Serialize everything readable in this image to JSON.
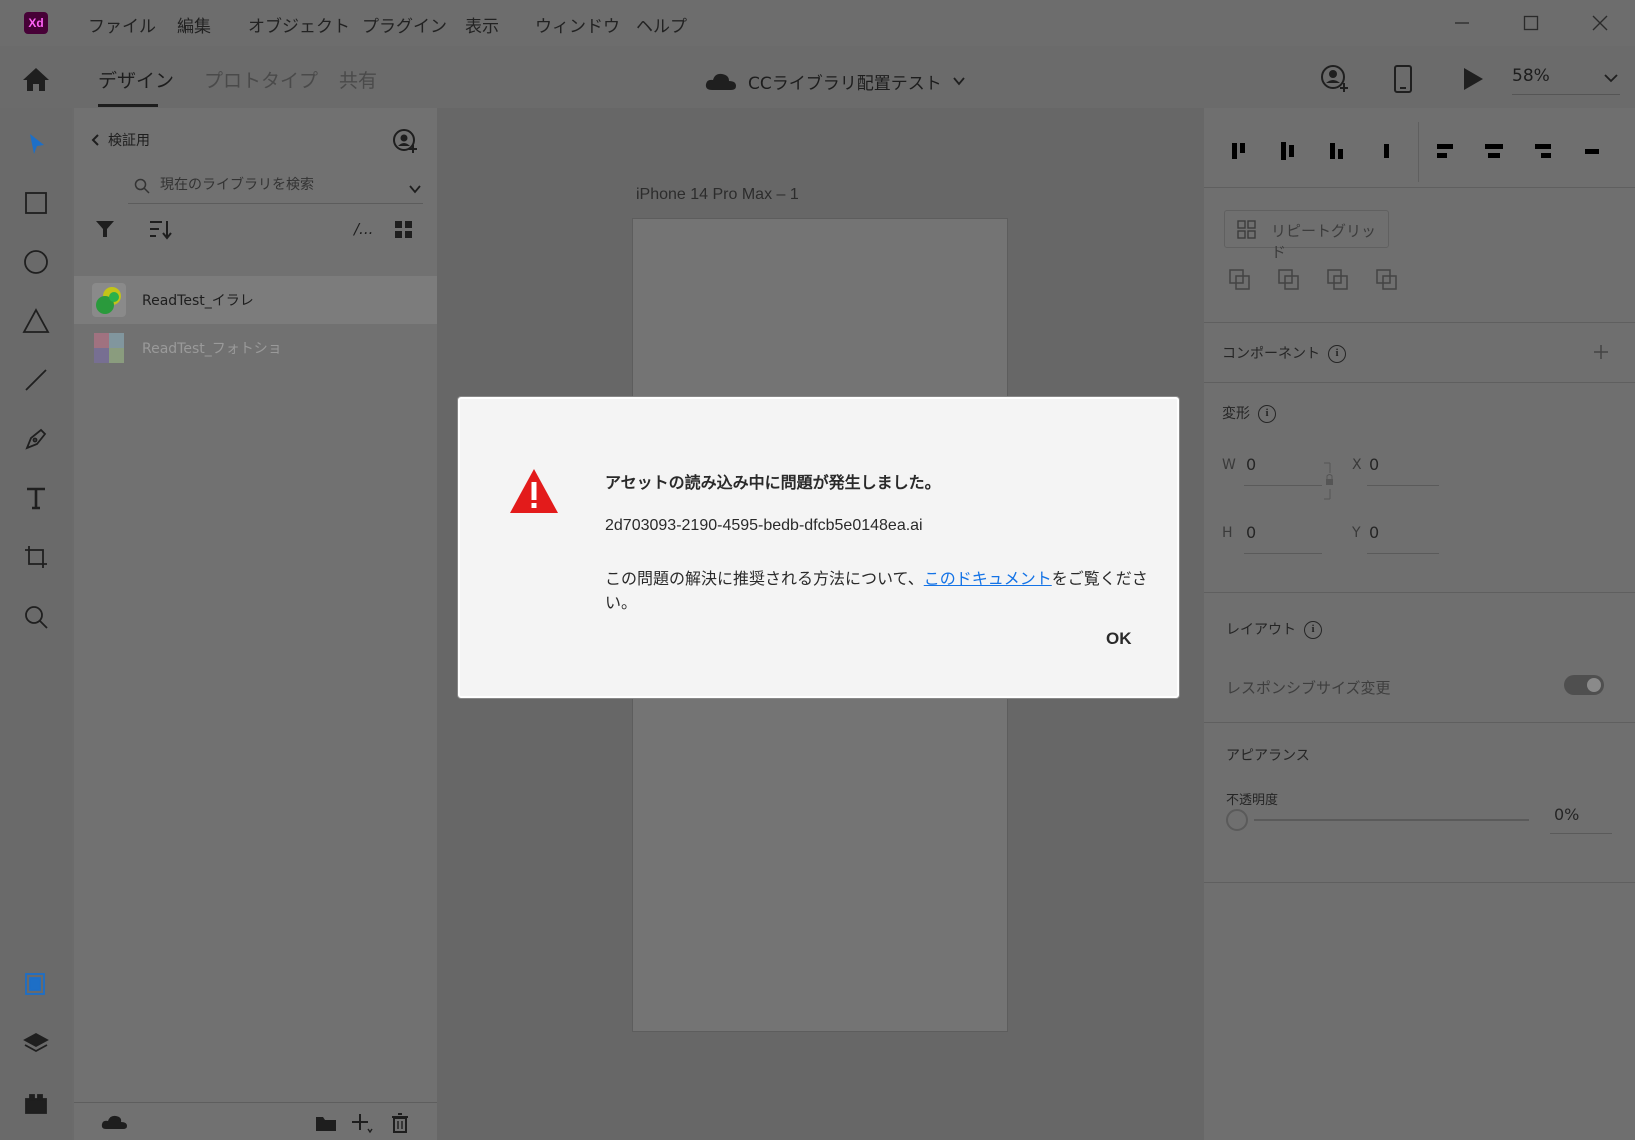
{
  "app": {
    "logo": "Xd",
    "menu": [
      "ファイル",
      "編集",
      "オブジェクト",
      "プラグイン",
      "表示",
      "ウィンドウ",
      "ヘルプ"
    ]
  },
  "header": {
    "tabs": [
      "デザイン",
      "プロトタイプ",
      "共有"
    ],
    "active_tab": "デザイン",
    "document_title": "CCライブラリ配置テスト",
    "zoom": "58%"
  },
  "library": {
    "back_label": "検証用",
    "search_placeholder": "現在のライブラリを検索",
    "view_label": "/...",
    "items": [
      {
        "name": "ReadTest_イラレ",
        "selected": true
      },
      {
        "name": "ReadTest_フォトショ",
        "selected": false
      }
    ]
  },
  "canvas": {
    "artboard_label": "iPhone 14 Pro Max – 1"
  },
  "properties": {
    "repeat_grid_label": "リピートグリッド",
    "component_label": "コンポーネント",
    "transform_label": "変形",
    "w_key": "W",
    "w_val": "0",
    "h_key": "H",
    "h_val": "0",
    "x_key": "X",
    "x_val": "0",
    "y_key": "Y",
    "y_val": "0",
    "layout_label": "レイアウト",
    "responsive_label": "レスポンシブサイズ変更",
    "appearance_label": "アピアランス",
    "opacity_label": "不透明度",
    "opacity_val": "0%"
  },
  "dialog": {
    "title": "アセットの読み込み中に問題が発生しました。",
    "file": "2d703093-2190-4595-bedb-dfcb5e0148ea.ai",
    "msg_before": "この問題の解決に推奨される方法について、",
    "link": "このドキュメント",
    "msg_after": "をご覧ください。",
    "ok_label": "OK"
  },
  "colors": {
    "warning": "#e31b1b",
    "link": "#1473e6",
    "select_tool": "#1d6fc7"
  }
}
